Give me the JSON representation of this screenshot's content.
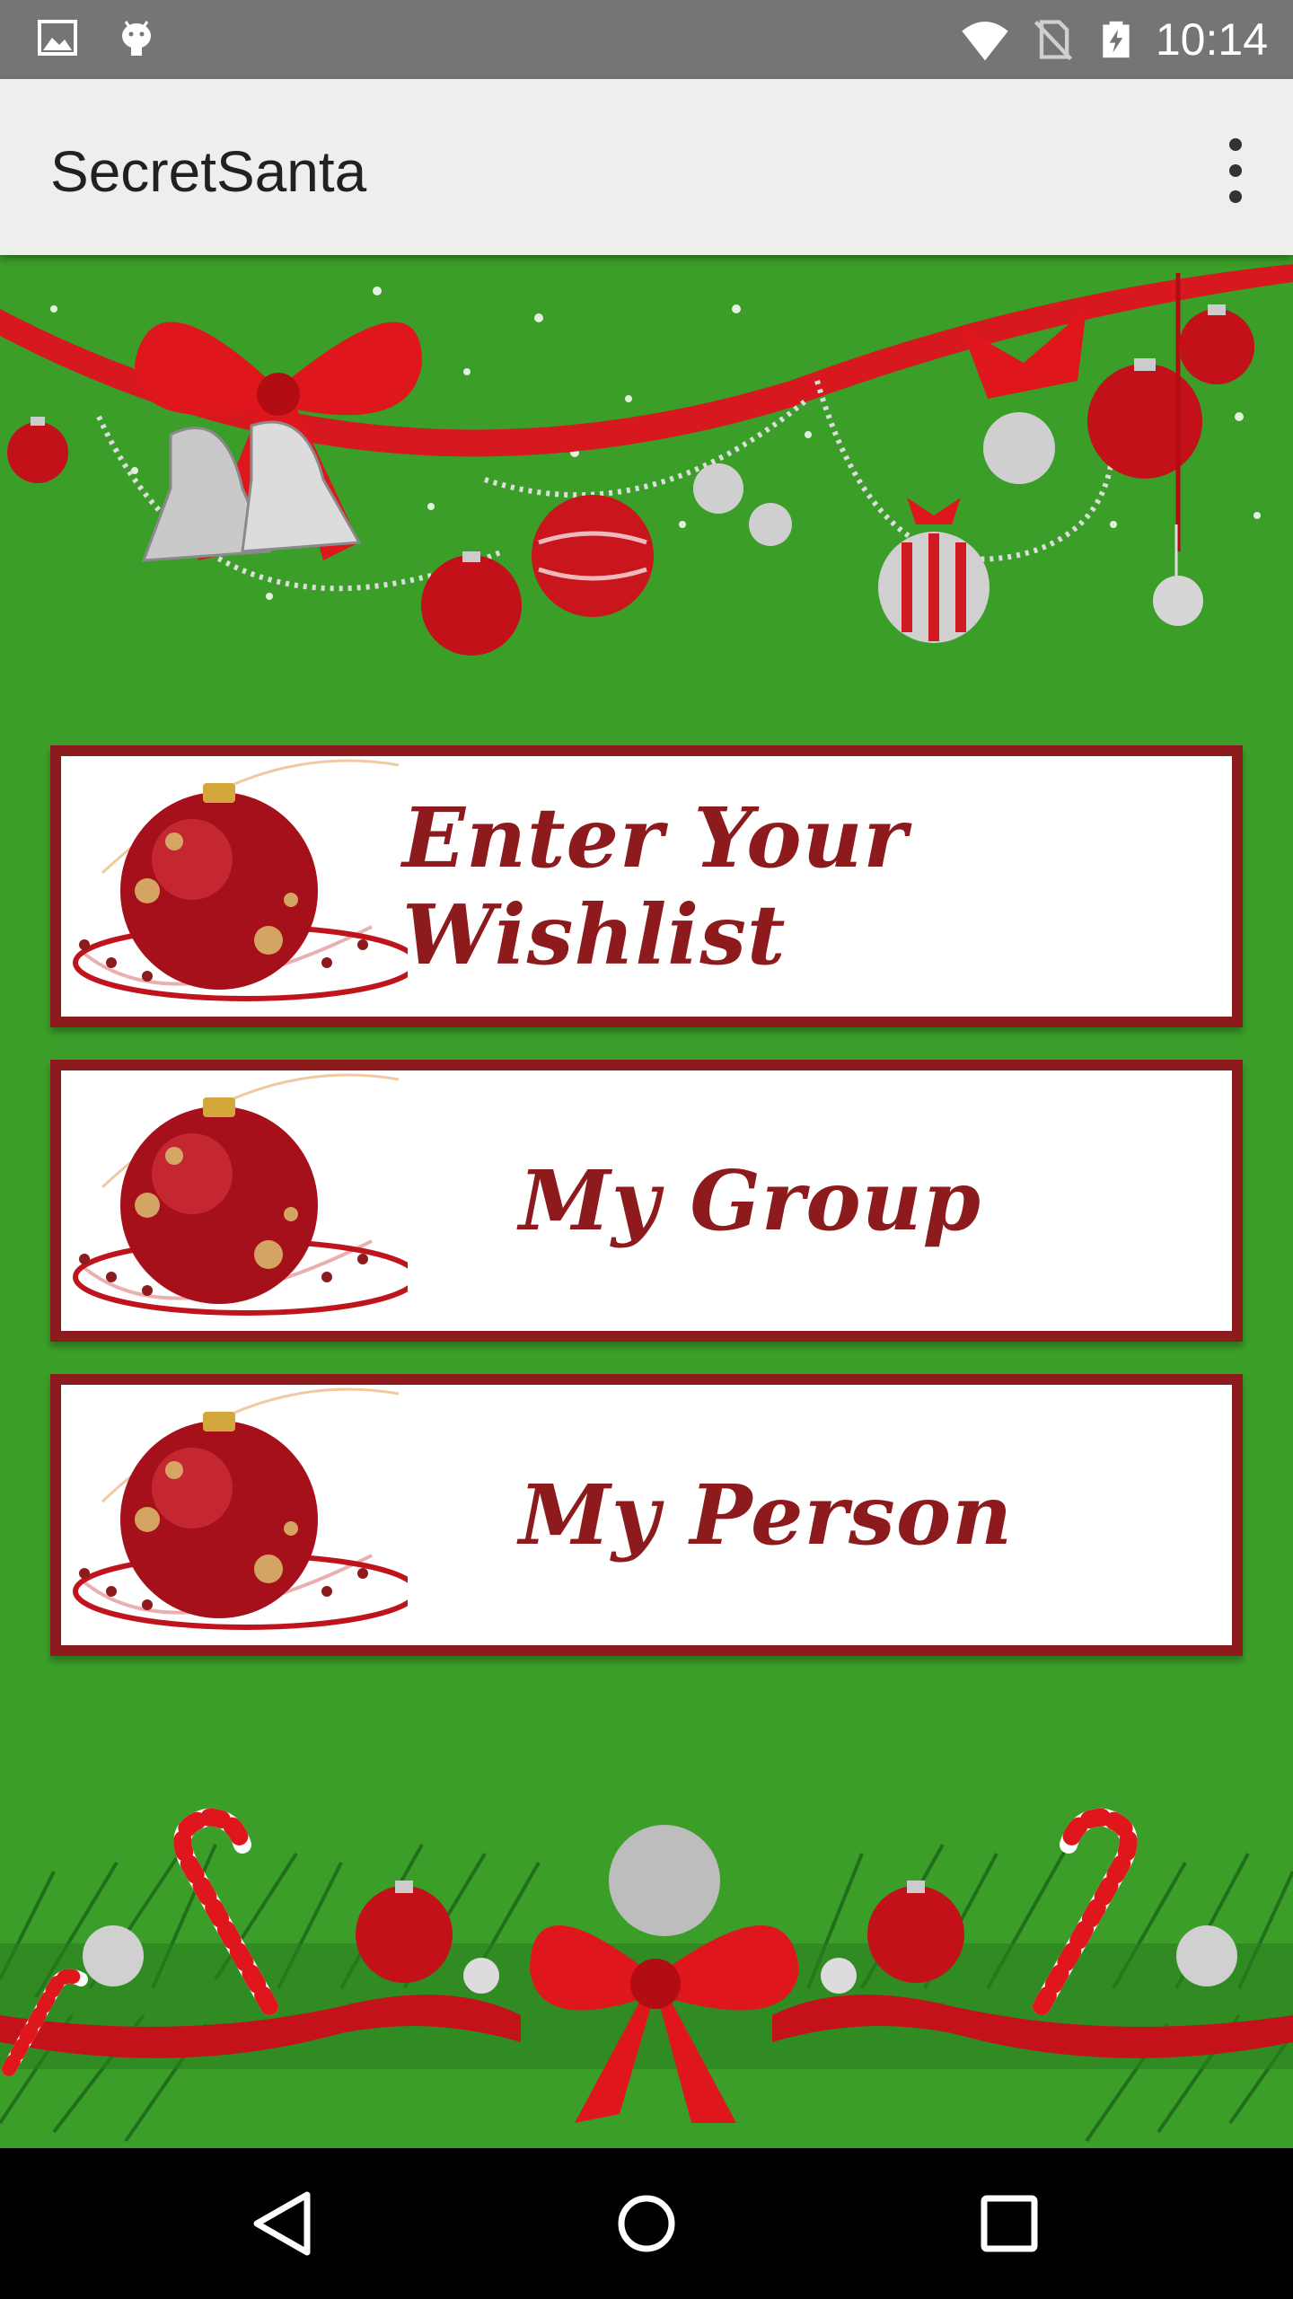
{
  "status_bar": {
    "time": "10:14",
    "icons": [
      "image-icon",
      "android-icon",
      "wifi-icon",
      "no-sim-icon",
      "battery-charging-icon"
    ]
  },
  "app_bar": {
    "title": "SecretSanta",
    "overflow_icon": "more-vert-icon"
  },
  "menu": {
    "buttons": [
      {
        "label": "Enter Your Wishlist",
        "icon": "ornament-icon"
      },
      {
        "label": "My Group",
        "icon": "ornament-icon"
      },
      {
        "label": "My Person",
        "icon": "ornament-icon"
      }
    ]
  },
  "colors": {
    "background_green": "#3a9e28",
    "button_border": "#8d1b1d",
    "label_red": "#8d1b1d",
    "app_bar": "#eeeeee",
    "status_bar": "#757575"
  },
  "nav_bar": {
    "icons": [
      "back-icon",
      "home-icon",
      "recents-icon"
    ]
  }
}
